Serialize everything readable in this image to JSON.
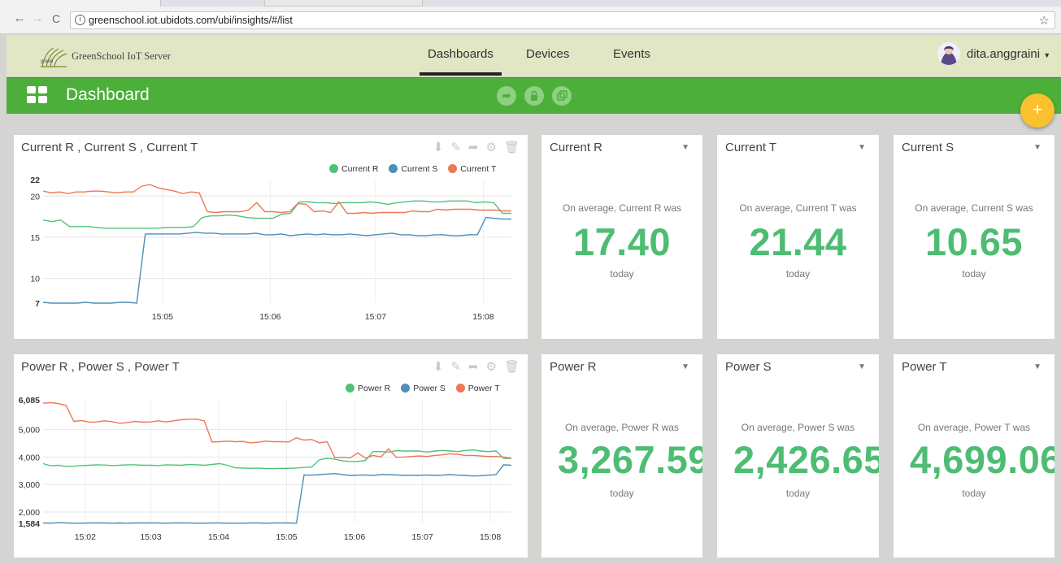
{
  "browser": {
    "url": "greenschool.iot.ubidots.com/ubi/insights/#/list",
    "back_icon": "←",
    "forward_icon": "→",
    "reload_icon": "C",
    "star_icon": "☆"
  },
  "app": {
    "logo_text": "GreenSchool IoT Server",
    "nav": [
      {
        "label": "Dashboards",
        "active": true
      },
      {
        "label": "Devices",
        "active": false
      },
      {
        "label": "Events",
        "active": false
      }
    ],
    "user": "dita.anggraini"
  },
  "dashboard": {
    "title": "Dashboard",
    "fab_label": "+",
    "colors": {
      "green_bar": "#4caf3a",
      "value_green": "#4ebd73",
      "series_r": "#4fc27a",
      "series_s": "#4d8fb6",
      "series_t": "#ee7756",
      "fab": "#fbc02d"
    }
  },
  "chart_data": [
    {
      "type": "line",
      "title": "Current R , Current S , Current T",
      "x_ticks": [
        "15:05",
        "15:06",
        "15:07",
        "15:08"
      ],
      "y_ticks": [
        "7",
        "10",
        "15",
        "20",
        "22"
      ],
      "ylim": [
        7,
        22
      ],
      "legend_position": "top-right",
      "series": [
        {
          "name": "Current R",
          "values": [
            17.1,
            16.9,
            17.1,
            16.3,
            16.3,
            16.3,
            16.2,
            16.1,
            16.1,
            16.1,
            16.1,
            16.1,
            16.1,
            16.1,
            16.2,
            16.2,
            16.2,
            16.3,
            17.4,
            17.6,
            17.6,
            17.7,
            17.6,
            17.4,
            17.3,
            17.3,
            17.3,
            17.8,
            17.9,
            19.3,
            19.3,
            19.2,
            19.2,
            19.1,
            19.2,
            19.2,
            19.2,
            19.3,
            19.2,
            19.0,
            19.2,
            19.3,
            19.4,
            19.4,
            19.3,
            19.3,
            19.4,
            19.4,
            19.4,
            19.2,
            19.3,
            19.2,
            17.9,
            17.9
          ]
        },
        {
          "name": "Current S",
          "values": [
            7.1,
            7.0,
            7.0,
            7.0,
            7.0,
            7.1,
            7.0,
            7.0,
            7.0,
            7.1,
            7.1,
            7.0,
            15.4,
            15.4,
            15.4,
            15.4,
            15.4,
            15.5,
            15.6,
            15.5,
            15.5,
            15.4,
            15.4,
            15.4,
            15.4,
            15.5,
            15.3,
            15.3,
            15.4,
            15.2,
            15.3,
            15.4,
            15.3,
            15.4,
            15.3,
            15.3,
            15.4,
            15.3,
            15.2,
            15.3,
            15.4,
            15.5,
            15.3,
            15.3,
            15.2,
            15.2,
            15.3,
            15.3,
            15.2,
            15.2,
            15.3,
            15.3,
            17.4,
            17.3,
            17.2,
            17.2
          ]
        },
        {
          "name": "Current T",
          "values": [
            20.6,
            20.4,
            20.5,
            20.3,
            20.5,
            20.5,
            20.6,
            20.6,
            20.5,
            20.4,
            20.5,
            20.5,
            21.2,
            21.4,
            21.0,
            20.8,
            20.6,
            20.3,
            20.5,
            20.4,
            18.1,
            18.0,
            18.1,
            18.1,
            18.1,
            18.3,
            19.2,
            18.1,
            18.1,
            18.0,
            18.1,
            19.1,
            19.0,
            18.1,
            18.2,
            18.0,
            19.3,
            17.9,
            17.9,
            18.0,
            17.9,
            18.0,
            18.0,
            18.0,
            18.0,
            18.2,
            18.1,
            18.1,
            18.4,
            18.3,
            18.4,
            18.4,
            18.4,
            18.3,
            18.3,
            18.3,
            18.2,
            18.2
          ]
        }
      ]
    },
    {
      "type": "line",
      "title": "Power R , Power S , Power T",
      "x_ticks": [
        "15:02",
        "15:03",
        "15:04",
        "15:05",
        "15:06",
        "15:07",
        "15:08"
      ],
      "y_ticks": [
        "1,584",
        "2,000",
        "3,000",
        "4,000",
        "5,000",
        "6,085"
      ],
      "ylim": [
        1584,
        6085
      ],
      "legend_position": "top-right",
      "series": [
        {
          "name": "Power R",
          "values": [
            3760,
            3680,
            3700,
            3660,
            3670,
            3690,
            3700,
            3720,
            3710,
            3690,
            3700,
            3720,
            3720,
            3700,
            3700,
            3690,
            3720,
            3710,
            3700,
            3730,
            3720,
            3700,
            3730,
            3760,
            3700,
            3610,
            3600,
            3590,
            3600,
            3580,
            3580,
            3590,
            3590,
            3600,
            3620,
            3640,
            3900,
            3960,
            3920,
            3860,
            3840,
            3840,
            3880,
            4200,
            4200,
            4180,
            4230,
            4220,
            4220,
            4220,
            4180,
            4220,
            4240,
            4220,
            4200,
            4240,
            4260,
            4220,
            4200,
            4220,
            3950,
            3950
          ]
        },
        {
          "name": "Power S",
          "values": [
            1600,
            1590,
            1610,
            1600,
            1590,
            1590,
            1600,
            1600,
            1600,
            1590,
            1600,
            1590,
            1600,
            1600,
            1600,
            1600,
            1590,
            1600,
            1600,
            1600,
            1590,
            1590,
            1600,
            1600,
            1590,
            1590,
            1590,
            1600,
            1600,
            1590,
            1600,
            1600,
            1600,
            1590,
            3350,
            3340,
            3360,
            3380,
            3400,
            3360,
            3330,
            3340,
            3350,
            3330,
            3360,
            3360,
            3350,
            3330,
            3340,
            3330,
            3350,
            3330,
            3340,
            3360,
            3340,
            3330,
            3310,
            3320,
            3340,
            3360,
            3720,
            3700
          ]
        },
        {
          "name": "Power T",
          "values": [
            5960,
            5980,
            5950,
            5880,
            5300,
            5330,
            5270,
            5280,
            5320,
            5290,
            5230,
            5260,
            5300,
            5270,
            5280,
            5320,
            5280,
            5320,
            5360,
            5380,
            5380,
            5320,
            4550,
            4560,
            4580,
            4560,
            4570,
            4520,
            4540,
            4580,
            4560,
            4560,
            4550,
            4700,
            4620,
            4640,
            4520,
            4560,
            3980,
            3990,
            3970,
            4150,
            3960,
            4060,
            4000,
            4300,
            3990,
            4000,
            4020,
            4040,
            4020,
            4060,
            4080,
            4120,
            4100,
            4060,
            4060,
            4040,
            4020,
            4020,
            4000,
            3960
          ]
        }
      ]
    }
  ],
  "cards": [
    {
      "title": "Current R",
      "subtitle": "On average, Current R was",
      "value": "17.40",
      "period": "today"
    },
    {
      "title": "Current T",
      "subtitle": "On average, Current T was",
      "value": "21.44",
      "period": "today"
    },
    {
      "title": "Current S",
      "subtitle": "On average, Current S was",
      "value": "10.65",
      "period": "today"
    },
    {
      "title": "Power R",
      "subtitle": "On average, Power R was",
      "value": "3,267.59",
      "period": "today"
    },
    {
      "title": "Power S",
      "subtitle": "On average, Power S was",
      "value": "2,426.65",
      "period": "today"
    },
    {
      "title": "Power T",
      "subtitle": "On average, Power T was",
      "value": "4,699.06",
      "period": "today"
    }
  ]
}
